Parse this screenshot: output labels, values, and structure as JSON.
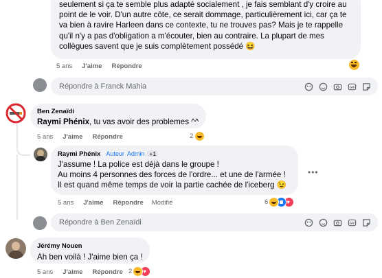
{
  "comment1": {
    "lines": [
      "seulement si ça te semble plus adapté socialement , je fais semblant d'y croire au",
      "point de le voir. D'un autre côte, ce serait dommage, particulièrement ici, car ça te",
      "va bien à ravire Harleen dans ce contexte, tu ne trouves pas? Mais je te rappelle",
      "qu'il n'y a pas d'obligation a m'écouter, bien au contraire. La plupart de mes",
      "collègues savent que je suis complètement possédé 😆"
    ],
    "time": "5 ans",
    "like": "J'aime",
    "reply": "Répondre"
  },
  "reply_box1": {
    "placeholder": "Répondre à Franck Mahia"
  },
  "comment2": {
    "author": "Ben Zenaïdi",
    "mention": "Raymi Phénix",
    "text": ", tu vas avoir des problemes ^^",
    "time": "5 ans",
    "like": "J'aime",
    "reply": "Répondre",
    "reaction_count": "2"
  },
  "comment3": {
    "author": "Raymi Phénix",
    "badge_author": "Auteur",
    "badge_admin": "Admin",
    "badge_more": "+1",
    "lines": [
      "J'assume ! La police est déjà dans le groupe !",
      "Au moins 4 personnes des forces de l'ordre... et une de l'armée !",
      "Il est quand même temps de voir la partie cachée de l'iceberg 😉"
    ],
    "time": "5 ans",
    "like": "J'aime",
    "reply": "Répondre",
    "edited": "Modifié",
    "reaction_count": "6"
  },
  "reply_box2": {
    "placeholder": "Répondre à Ben Zenaïdi"
  },
  "comment4": {
    "author": "Jérémy Nouen",
    "text": "Ah ben voilà ! J'aime bien ça !",
    "time": "5 ans",
    "like": "J'aime",
    "reply": "Répondre",
    "reaction_count": "2"
  },
  "colors": {
    "bubble": "#f0f2f5",
    "meta": "#65676b",
    "like_blue": "#1877f2",
    "love_red": "#f33e58",
    "haha_yellow": "#f7b928"
  },
  "icons": [
    "sticker-icon",
    "gif-icon",
    "emoji-icon",
    "camera-icon",
    "avatar-sticker-icon"
  ]
}
